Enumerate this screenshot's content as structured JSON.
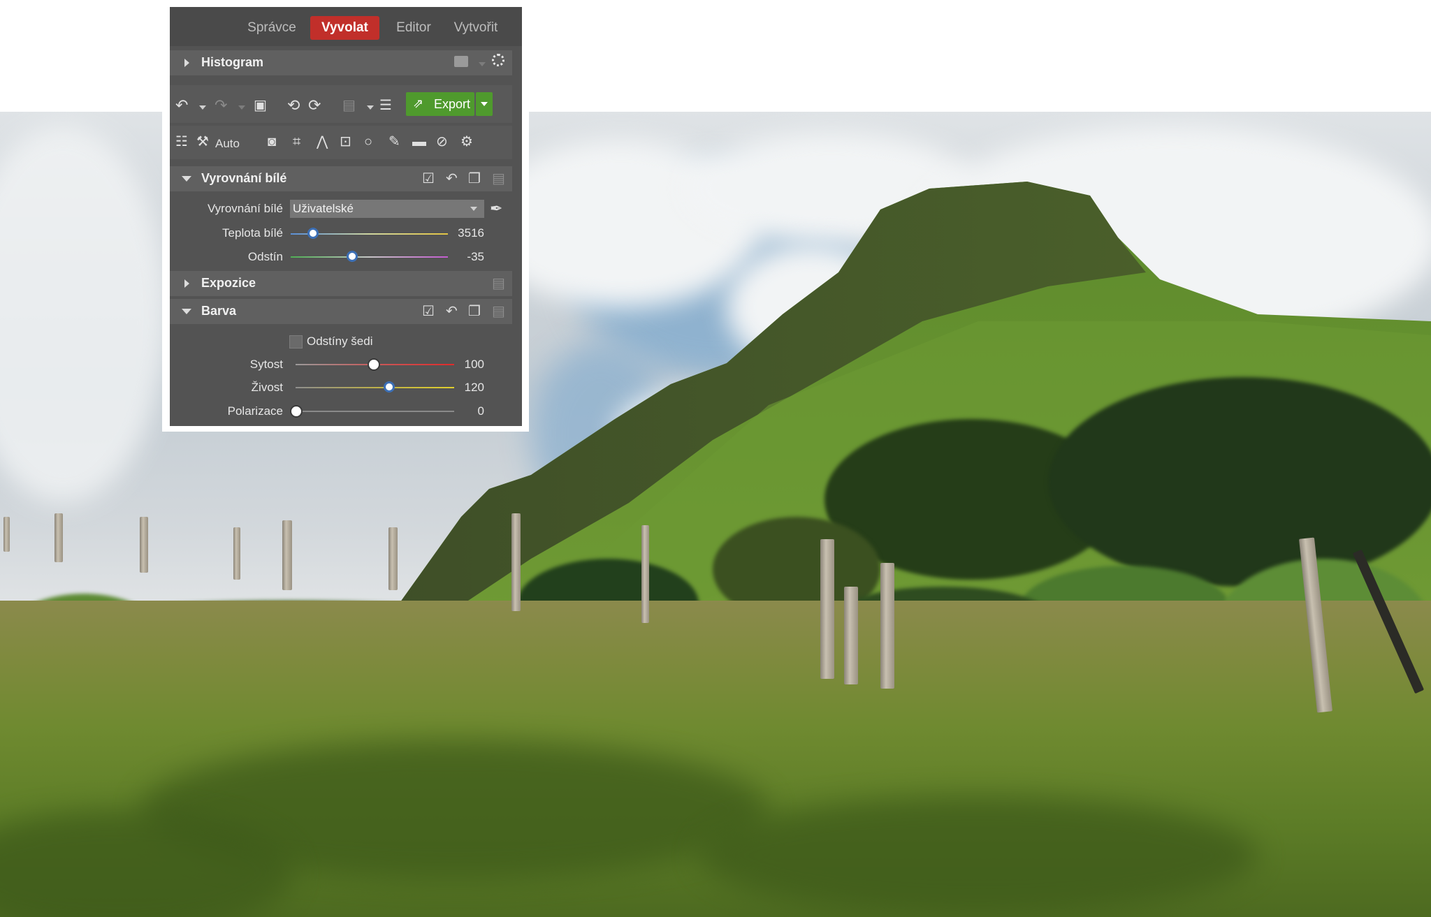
{
  "tabs": [
    {
      "label": "Správce",
      "active": false
    },
    {
      "label": "Vyvolat",
      "active": true
    },
    {
      "label": "Editor",
      "active": false
    },
    {
      "label": "Vytvořit",
      "active": false
    }
  ],
  "sections": {
    "histogram": {
      "title": "Histogram",
      "expanded": false
    },
    "white_balance": {
      "title": "Vyrovnání bílé",
      "expanded": true
    },
    "exposure": {
      "title": "Expozice",
      "expanded": false
    },
    "color": {
      "title": "Barva",
      "expanded": true
    }
  },
  "toolbar": {
    "export_label": "Export",
    "auto_label": "Auto"
  },
  "white_balance": {
    "mode_label": "Vyrovnání bílé",
    "mode_value": "Uživatelské",
    "temperature": {
      "label": "Teplota bílé",
      "value": "3516",
      "fraction": 0.14
    },
    "tint": {
      "label": "Odstín",
      "value": "-35",
      "fraction": 0.39
    }
  },
  "color": {
    "grayscale_label": "Odstíny šedi",
    "grayscale_checked": false,
    "saturation": {
      "label": "Sytost",
      "value": "100",
      "fraction": 0.49
    },
    "vibrance": {
      "label": "Živost",
      "value": "120",
      "fraction": 0.59
    },
    "polarization": {
      "label": "Polarizace",
      "value": "0",
      "fraction": 0.0
    }
  },
  "colors": {
    "active_tab": "#c12f2a",
    "export_button": "#4f9a2d",
    "panel_bg": "#535353",
    "knob_accent": "#3c6fb5"
  },
  "icons": [
    "undo-icon",
    "redo-icon",
    "image-icon",
    "rotate-left-icon",
    "rotate-right-icon",
    "save-icon",
    "presets-icon",
    "export-icon",
    "sliders-icon",
    "auto-wand-icon",
    "camera-icon",
    "crop-icon",
    "perspective-icon",
    "text-frame-icon",
    "circle-icon",
    "brush-icon",
    "gradient-icon",
    "healing-icon",
    "settings-icon",
    "checkbox-icon",
    "reset-icon",
    "copy-icon",
    "paste-icon",
    "eyedropper-icon",
    "sun-icon"
  ]
}
